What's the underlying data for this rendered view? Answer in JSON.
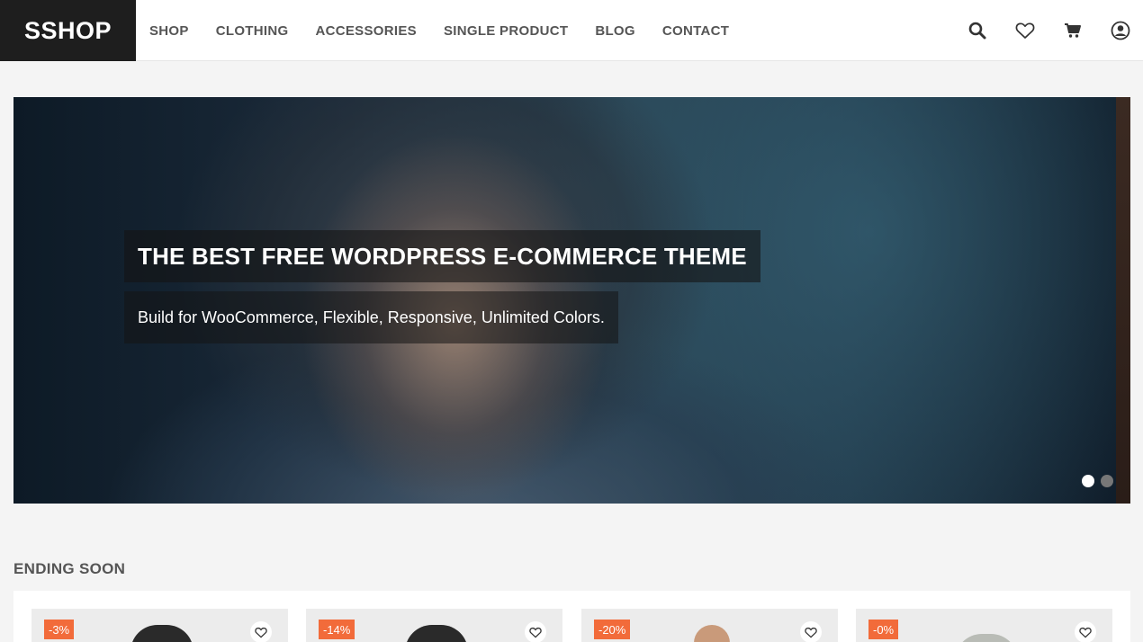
{
  "brand": {
    "logo": "SSHOP"
  },
  "nav": {
    "items": [
      {
        "label": "SHOP"
      },
      {
        "label": "CLOTHING"
      },
      {
        "label": "ACCESSORIES"
      },
      {
        "label": "SINGLE PRODUCT"
      },
      {
        "label": "BLOG"
      },
      {
        "label": "CONTACT"
      }
    ]
  },
  "header_actions": [
    "search-icon",
    "heart-icon",
    "cart-icon",
    "user-icon"
  ],
  "hero": {
    "title": "THE BEST FREE WORDPRESS E-COMMERCE THEME",
    "subtitle": "Build for WooCommerce, Flexible, Responsive, Unlimited Colors.",
    "slides_total": 2,
    "active_slide": 1
  },
  "section": {
    "title": "ENDING SOON"
  },
  "products": [
    {
      "badge": "-3%"
    },
    {
      "badge": "-14%"
    },
    {
      "badge": "-20%"
    },
    {
      "badge": "-0%"
    }
  ],
  "colors": {
    "logo_bg": "#1e1e1e",
    "accent_badge": "#f26b3a",
    "dot_active": "#ffffff",
    "dot_inactive": "#777777"
  }
}
